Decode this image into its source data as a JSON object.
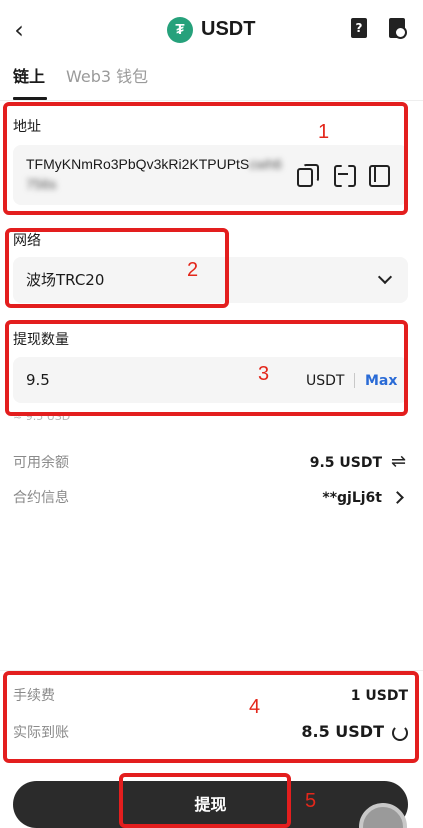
{
  "header": {
    "title": "USDT",
    "coin_symbol": "₮",
    "help_glyph": "?",
    "back_glyph": "‹"
  },
  "tabs": [
    {
      "label": "链上",
      "active": true
    },
    {
      "label": "Web3 钱包",
      "active": false
    }
  ],
  "address": {
    "label": "地址",
    "value_visible": "TFMyKNmRo3PbQv3kRi2KTPUPtS",
    "value_blurred": "cwh6756s"
  },
  "network": {
    "label": "网络",
    "value": "波场TRC20"
  },
  "amount": {
    "label": "提现数量",
    "value": "9.5",
    "unit": "USDT",
    "max_label": "Max",
    "fiat_hint": "≈ 9.5 USD"
  },
  "info_rows": {
    "available": {
      "label": "可用余额",
      "value": "9.5 USDT"
    },
    "contract": {
      "label": "合约信息",
      "value": "**gjLj6t"
    }
  },
  "fees": {
    "fee": {
      "label": "手续费",
      "value": "1 USDT"
    },
    "received": {
      "label": "实际到账",
      "value": "8.5 USDT"
    }
  },
  "submit_label": "提现",
  "annotations": [
    "1",
    "2",
    "3",
    "4",
    "5"
  ],
  "colors": {
    "accent_blue": "#2a6bd6",
    "tether_green": "#26a17b",
    "annotation_red": "#e31e1e",
    "button_dark": "#2b2b2b"
  }
}
